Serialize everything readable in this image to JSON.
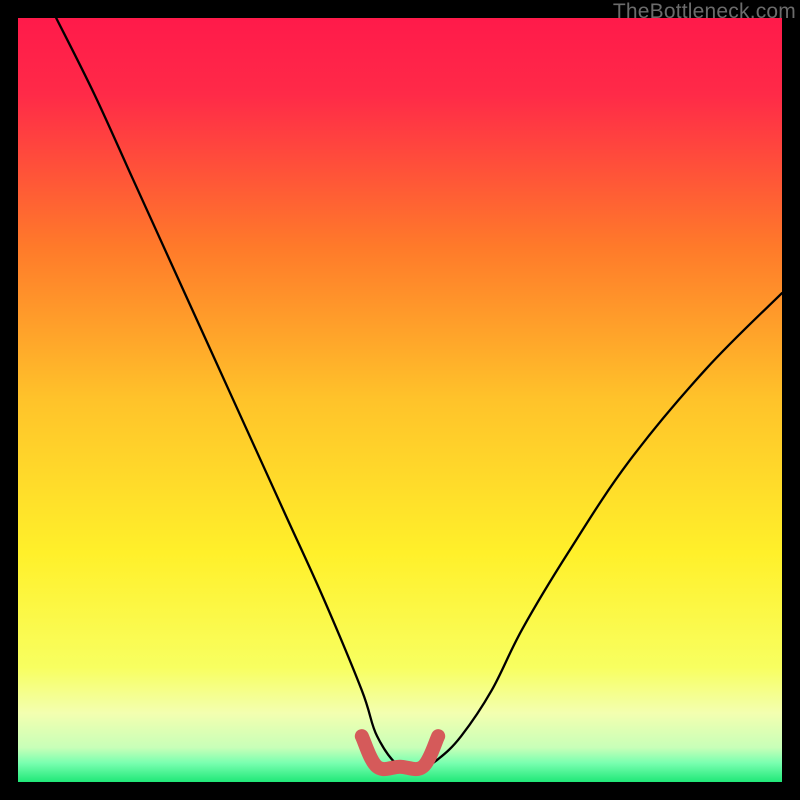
{
  "watermark": "TheBottleneck.com",
  "colors": {
    "gradient_top": "#ff1a4a",
    "gradient_mid1": "#ff6a2a",
    "gradient_mid2": "#ffe62a",
    "gradient_bottom_band": "#f5ff9a",
    "gradient_bottom": "#2aff88",
    "curve": "#000000",
    "highlight": "#d55a5a",
    "frame_bg": "#000000"
  },
  "chart_data": {
    "type": "line",
    "title": "",
    "xlabel": "",
    "ylabel": "",
    "xlim": [
      0,
      100
    ],
    "ylim": [
      0,
      100
    ],
    "series": [
      {
        "name": "bottleneck-curve",
        "x": [
          5,
          10,
          15,
          20,
          25,
          30,
          35,
          40,
          45,
          47,
          50,
          53,
          55,
          58,
          62,
          66,
          72,
          80,
          90,
          100
        ],
        "y": [
          100,
          90,
          79,
          68,
          57,
          46,
          35,
          24,
          12,
          6,
          2,
          2,
          3,
          6,
          12,
          20,
          30,
          42,
          54,
          64
        ]
      }
    ],
    "highlight_segment": {
      "name": "flat-minimum",
      "x": [
        45,
        47,
        50,
        53,
        55
      ],
      "y": [
        6,
        2,
        2,
        2,
        6
      ]
    }
  }
}
